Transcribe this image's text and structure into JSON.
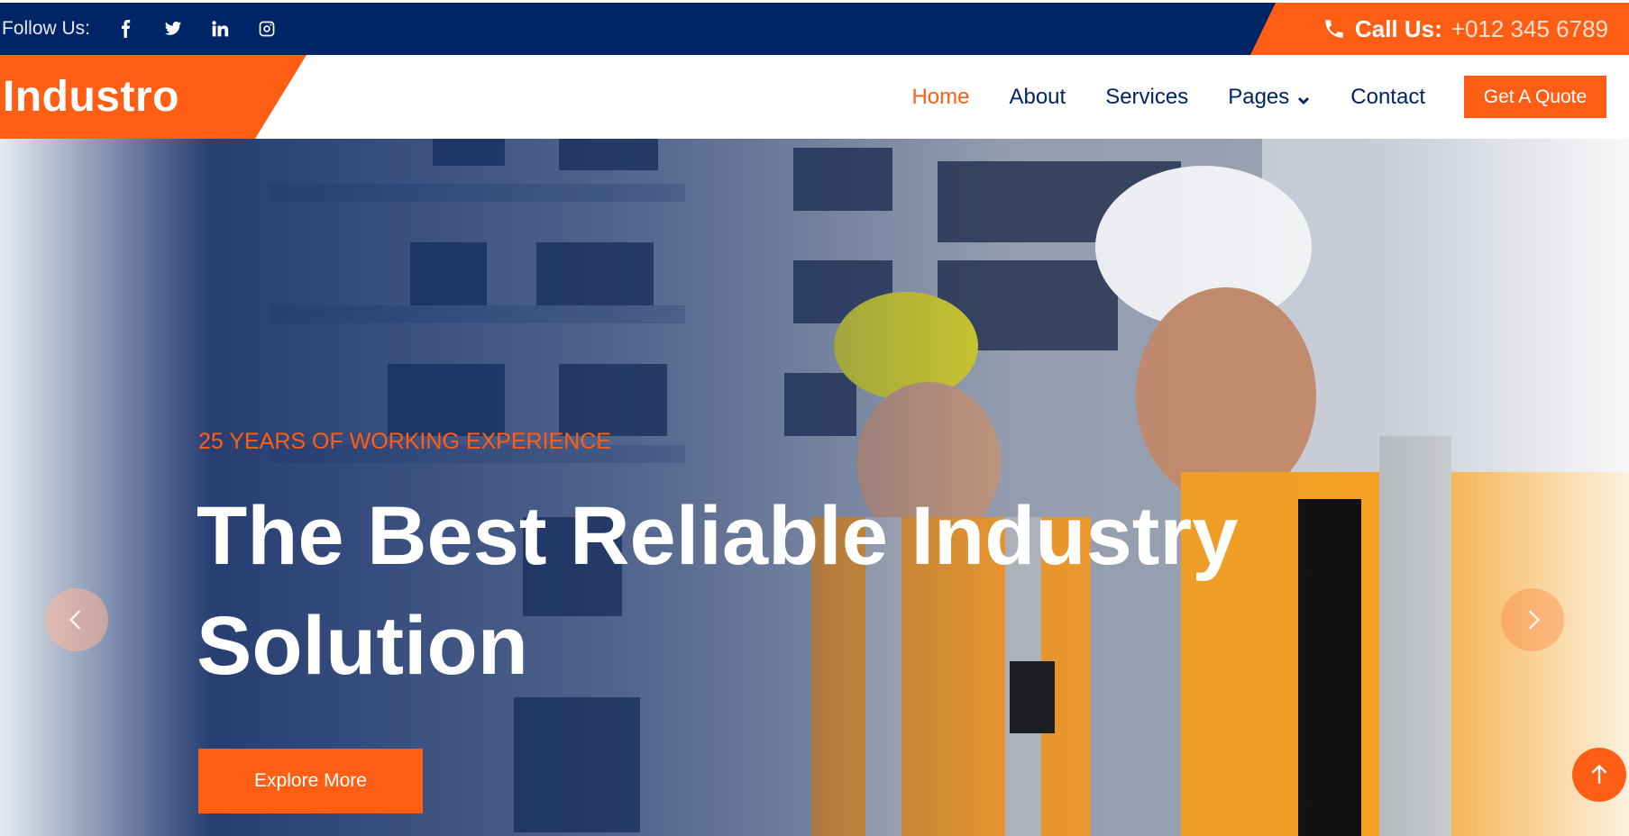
{
  "topbar": {
    "follow_label": "Follow Us:",
    "social": [
      {
        "icon": "facebook-icon"
      },
      {
        "icon": "twitter-icon"
      },
      {
        "icon": "linkedin-icon"
      },
      {
        "icon": "instagram-icon"
      }
    ],
    "call_label": "Call Us:",
    "phone": "+012 345 6789"
  },
  "nav": {
    "brand": "Industro",
    "items": [
      {
        "label": "Home",
        "active": true
      },
      {
        "label": "About"
      },
      {
        "label": "Services"
      },
      {
        "label": "Pages",
        "dropdown": true
      },
      {
        "label": "Contact"
      }
    ],
    "quote_label": "Get A Quote"
  },
  "hero": {
    "kicker": "25 YEARS OF WORKING EXPERIENCE",
    "headline_line1": "The Best Reliable Industry",
    "headline_line2": "Solution",
    "cta_label": "Explore More"
  },
  "colors": {
    "accent": "#ff5e14",
    "navy": "#002466"
  }
}
